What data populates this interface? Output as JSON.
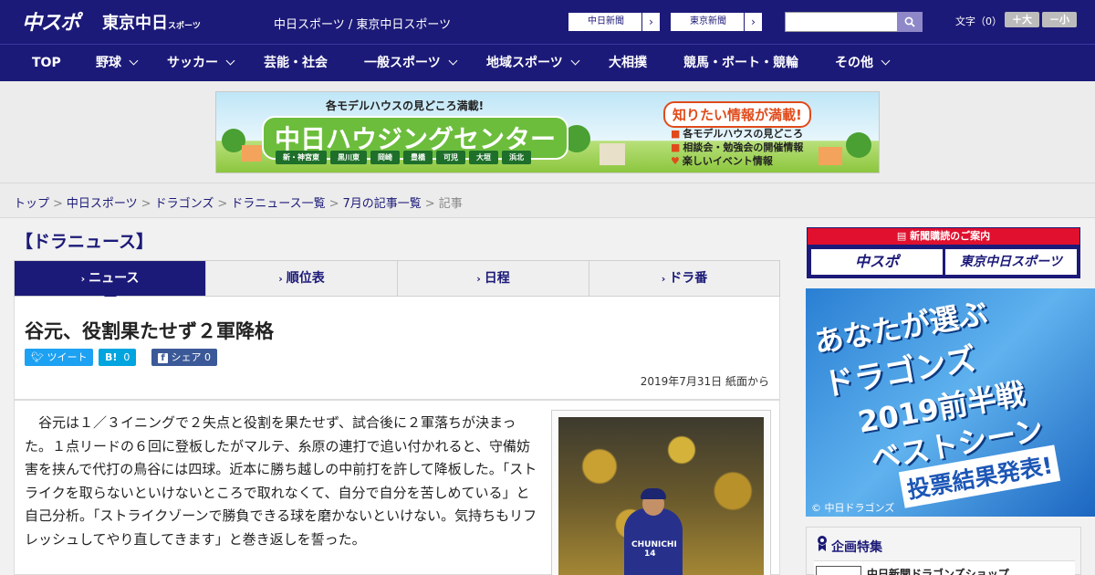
{
  "header": {
    "logo_main": "中スポ",
    "logo_sub": "東京中日",
    "logo_sub_small": "スポーツ",
    "site_title": "中日スポーツ / 東京中日スポーツ",
    "ext_links": [
      {
        "label": "中日新聞"
      },
      {
        "label": "東京新聞"
      }
    ],
    "search_placeholder": "",
    "fontsize_label": "文字（0）",
    "font_larger": "＋大",
    "font_smaller": "－小"
  },
  "nav": {
    "items": [
      {
        "label": "TOP",
        "dropdown": false
      },
      {
        "label": "野球",
        "dropdown": true
      },
      {
        "label": "サッカー",
        "dropdown": true
      },
      {
        "label": "芸能・社会",
        "dropdown": false
      },
      {
        "label": "一般スポーツ",
        "dropdown": true
      },
      {
        "label": "地域スポーツ",
        "dropdown": true
      },
      {
        "label": "大相撲",
        "dropdown": false
      },
      {
        "label": "競馬・ボート・競輪",
        "dropdown": false
      },
      {
        "label": "その他",
        "dropdown": true
      }
    ]
  },
  "banner": {
    "tagline": "各モデルハウスの見どころ満載!",
    "title": "中日ハウジングセンター",
    "cities": [
      "新・神宮東",
      "黒川東",
      "岡崎",
      "豊橋",
      "可児",
      "大垣",
      "浜北"
    ],
    "right_title": "知りたい情報が満載!",
    "right_lines": [
      "各モデルハウスの見どころ",
      "相談会・勉強会の開催情報",
      "楽しいイベント情報"
    ]
  },
  "breadcrumb": {
    "items": [
      "トップ",
      "中日スポーツ",
      "ドラゴンズ",
      "ドラニュース一覧",
      "7月の記事一覧"
    ],
    "current": "記事",
    "separator": ">"
  },
  "section": {
    "title": "【ドラニュース】"
  },
  "tabs": [
    {
      "label": "ニュース",
      "active": true
    },
    {
      "label": "順位表",
      "active": false
    },
    {
      "label": "日程",
      "active": false
    },
    {
      "label": "ドラ番",
      "active": false
    }
  ],
  "article": {
    "headline": "谷元、役割果たせず２軍降格",
    "share": {
      "tweet": "ツイート",
      "hatena_label": "B!",
      "hatena_count": "0",
      "facebook": "シェア",
      "facebook_count": "0"
    },
    "dateline": "2019年7月31日 紙面から",
    "body": "谷元は１／３イニングで２失点と役割を果たせず、試合後に２軍落ちが決まった。１点リードの６回に登板したがマルテ、糸原の連打で追い付かれると、守備妨害を挟んで代打の鳥谷には四球。近本に勝ち越しの中前打を許して降板した。「ストライクを取らないといけないところで取れなくて、自分で自分を苦しめている」と自己分析。「ストライクゾーンで勝負できる球を磨かないといけない。気持ちもリフレッシュしてやり直してきます」と巻き返しを誓った。",
    "photo_jersey": "CHUNICHI",
    "photo_number": "14"
  },
  "sidebar": {
    "subscription_header": "新聞購読のご案内",
    "subscription_buttons": [
      "中スポ",
      "東京中日スポーツ"
    ],
    "promo_lines": [
      "あなたが選ぶ",
      "ドラゴンズ",
      "2019前半戦",
      "ベストシーン"
    ],
    "promo_result": "投票結果発表!",
    "promo_copyright": "© 中日ドラゴンズ",
    "feature_title": "企画特集",
    "feature_item": "中日新聞ドラゴンズショップ"
  },
  "colors": {
    "brand_navy": "#1c1a78",
    "twitter": "#1da1f2",
    "hatena": "#00a4de",
    "facebook": "#3b5998",
    "subscription_red": "#e0102e"
  }
}
